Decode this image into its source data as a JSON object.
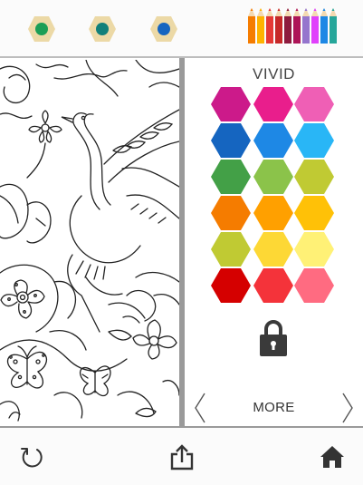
{
  "palette": {
    "title": "VIVID",
    "rows": [
      [
        "#cc1a8a",
        "#e91e8c",
        "#ef5fb5"
      ],
      [
        "#1565c0",
        "#1e88e5",
        "#29b6f6"
      ],
      [
        "#43a047",
        "#8bc34a",
        "#c0ca33"
      ],
      [
        "#f57c00",
        "#ffa000",
        "#ffc107"
      ],
      [
        "#c0ca33",
        "#fdd835",
        "#fff176"
      ],
      [
        "#d50000",
        "#f4333a",
        "#ff6b81"
      ]
    ],
    "locked": true,
    "more_label": "MORE"
  },
  "recent_colors": [
    "#1b9e56",
    "#11807a",
    "#1565c0"
  ],
  "recent_frame_color": "#ecd9a6",
  "pencil_colors": [
    "#f57c00",
    "#ffb300",
    "#e53935",
    "#c62828",
    "#8e1b3e",
    "#ad1457",
    "#9575cd",
    "#e040fb",
    "#1e88e5",
    "#26a69a"
  ],
  "toolbar": {
    "undo": "undo-icon",
    "share": "share-icon",
    "home": "home-icon"
  }
}
